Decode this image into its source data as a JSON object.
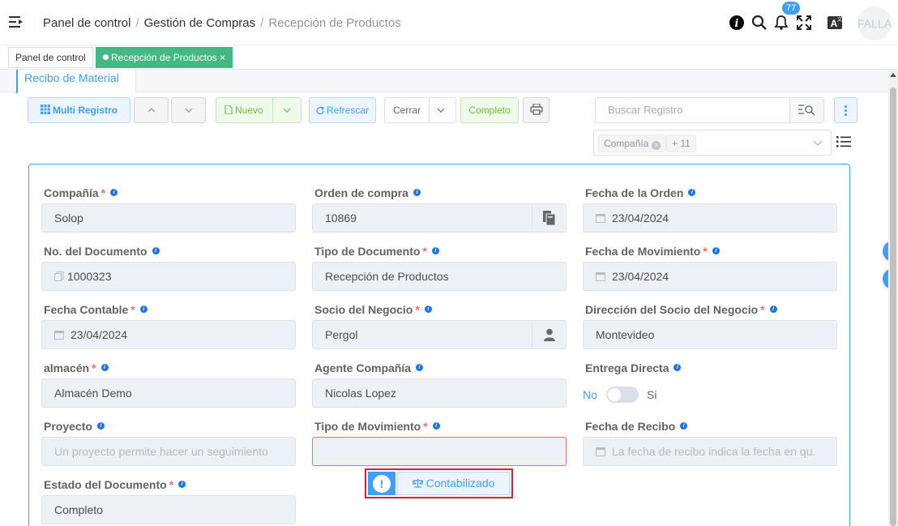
{
  "header": {
    "breadcrumb": [
      "Panel de control",
      "Gestión de Compras",
      "Recepción de Productos"
    ],
    "notification_count": "77",
    "avatar_text": "FALLA"
  },
  "tags": {
    "dashboard": "Panel de control",
    "active": "Recepción de Productos",
    "close": "×"
  },
  "window": {
    "tab_label": "Recibo de Material"
  },
  "toolbar": {
    "multi_record": "Multi Registro",
    "new": "Nuevo",
    "refresh": "Refrescar",
    "close": "Cerrar",
    "complete": "Completo",
    "search_placeholder": "Buscar Registro",
    "filter_chip": "Compañía",
    "filter_more": "+ 11"
  },
  "form": {
    "company": {
      "label": "Compañía",
      "value": "Solop"
    },
    "purchase_order": {
      "label": "Orden de compra",
      "value": "10869"
    },
    "order_date": {
      "label": "Fecha de la Orden",
      "value": "23/04/2024"
    },
    "document_no": {
      "label": "No. del Documento",
      "value": "1000323"
    },
    "document_type": {
      "label": "Tipo de Documento",
      "value": "Recepción de Productos"
    },
    "movement_date": {
      "label": "Fecha de Movimiento",
      "value": "23/04/2024"
    },
    "accounting_date": {
      "label": "Fecha Contable",
      "value": "23/04/2024"
    },
    "business_partner": {
      "label": "Socio del Negocio",
      "value": "Pergol"
    },
    "partner_address": {
      "label": "Dirección del Socio del Negocio",
      "value": "Montevideo"
    },
    "warehouse": {
      "label": "almacén",
      "value": "Almacén Demo"
    },
    "company_agent": {
      "label": "Agente Compañía",
      "value": "Nicolas Lopez"
    },
    "direct_delivery": {
      "label": "Entrega Directa",
      "no": "No",
      "yes": "Si"
    },
    "project": {
      "label": "Proyecto",
      "placeholder": "Un proyecto permite hacer un seguimiento"
    },
    "movement_type": {
      "label": "Tipo de Movimiento",
      "value": ""
    },
    "receipt_date": {
      "label": "Fecha de Recibo",
      "placeholder": "La fecha de recibo indica la fecha en qu."
    },
    "document_status": {
      "label": "Estado del Documento",
      "value": "Completo"
    },
    "posted_button": "Contabilizado"
  }
}
